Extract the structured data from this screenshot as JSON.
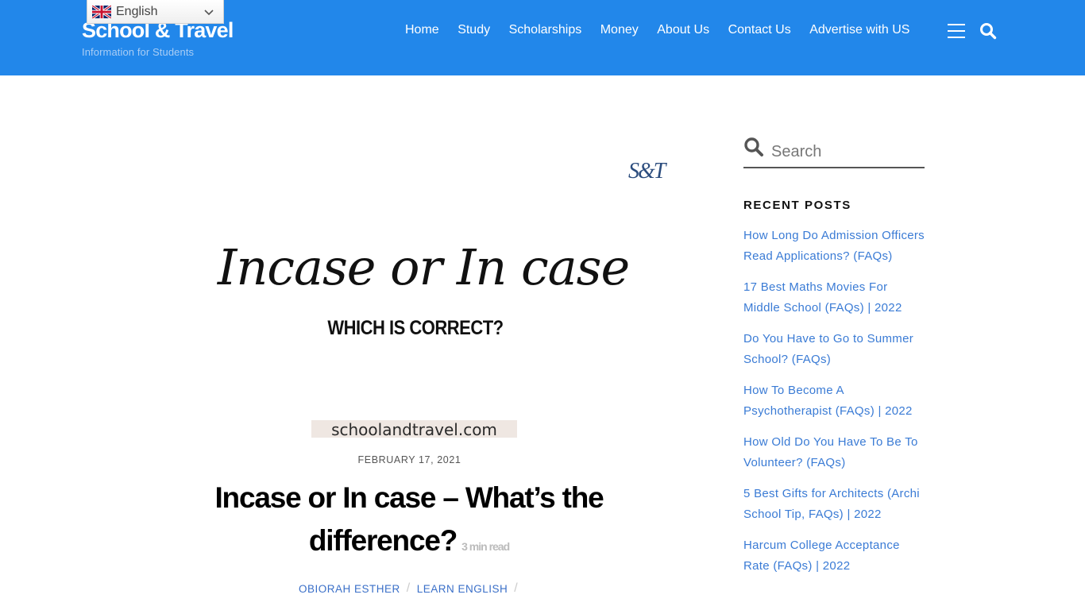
{
  "header": {
    "site_title": "School & Travel",
    "tagline": "Information for Students",
    "brand_color": "#2287ea",
    "language_selector": {
      "selected": "English",
      "flag_icon": "uk-flag-icon"
    },
    "nav": [
      {
        "label": "Home"
      },
      {
        "label": "Study"
      },
      {
        "label": "Scholarships"
      },
      {
        "label": "Money"
      },
      {
        "label": "About Us"
      },
      {
        "label": "Contact Us"
      },
      {
        "label": "Advertise with US"
      }
    ],
    "menu_icon": "hamburger-icon",
    "search_icon": "search-icon"
  },
  "featured_image": {
    "logo": "S&T",
    "title": "Incase or In case",
    "subtitle": "WHICH IS CORRECT?",
    "url": "schoolandtravel.com"
  },
  "post": {
    "date": "FEBRUARY 17, 2021",
    "title": "Incase or In case – What’s the difference?",
    "read_time": "3 min read",
    "author": "OBIORAH ESTHER",
    "category": "LEARN ENGLISH",
    "separator": "/"
  },
  "sidebar": {
    "search_placeholder": "Search",
    "recent_posts_heading": "RECENT POSTS",
    "recent_posts": [
      {
        "title": "How Long Do Admission Officers Read Applications? (FAQs)"
      },
      {
        "title": "17 Best Maths Movies For Middle School (FAQs) | 2022"
      },
      {
        "title": "Do You Have to Go to Summer School? (FAQs)"
      },
      {
        "title": "How To Become A Psychotherapist (FAQs) | 2022"
      },
      {
        "title": "How Old Do You Have To Be To Volunteer? (FAQs)"
      },
      {
        "title": "5 Best Gifts for Architects (Archi School Tip, FAQs) | 2022"
      },
      {
        "title": "Harcum College Acceptance Rate (FAQs) | 2022"
      }
    ],
    "link_color": "#3a7bd5"
  }
}
